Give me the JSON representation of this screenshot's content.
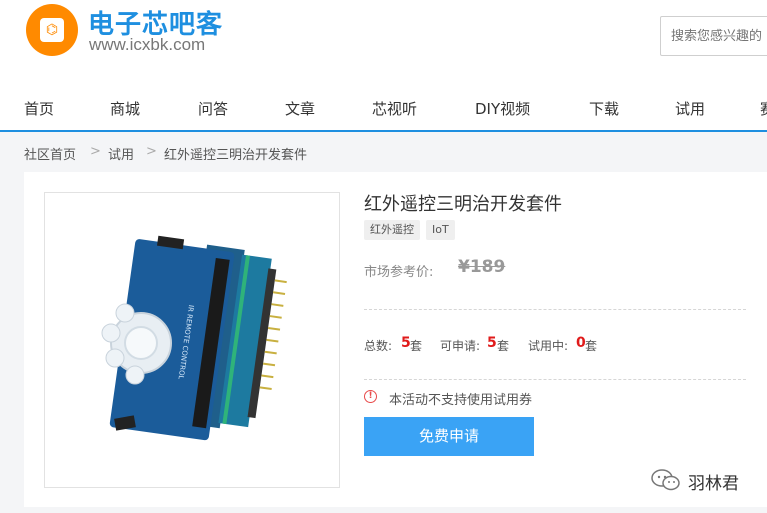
{
  "header": {
    "brand_cn": "电子芯吧客",
    "brand_url": "www.icxbk.com",
    "search_placeholder": "搜索您感兴趣的"
  },
  "nav": {
    "items": [
      "首页",
      "商城",
      "问答",
      "文章",
      "芯视听",
      "DIY视频",
      "下载",
      "试用",
      "赛"
    ]
  },
  "breadcrumb": [
    "社区首页",
    "试用",
    "红外遥控三明治开发套件"
  ],
  "breadcrumb_separator": ">",
  "product": {
    "title": "红外遥控三明治开发套件",
    "tags": [
      "红外遥控",
      "IoT"
    ],
    "price_label": "市场参考价:",
    "price_value": "¥189",
    "stats": {
      "total_label": "总数:",
      "total_value": "5",
      "available_label": "可申请:",
      "available_value": "5",
      "trial_label": "试用中:",
      "trial_value": "0",
      "unit": "套"
    },
    "notice": "本活动不支持使用试用券",
    "apply_button": "免费申请"
  },
  "watermark": "羽林君",
  "colors": {
    "brand_blue": "#1e8fe0",
    "brand_orange": "#ff8a00",
    "button_blue": "#3aa3f5",
    "stat_red": "#e01b1b",
    "notice_red": "#e84a4a"
  }
}
